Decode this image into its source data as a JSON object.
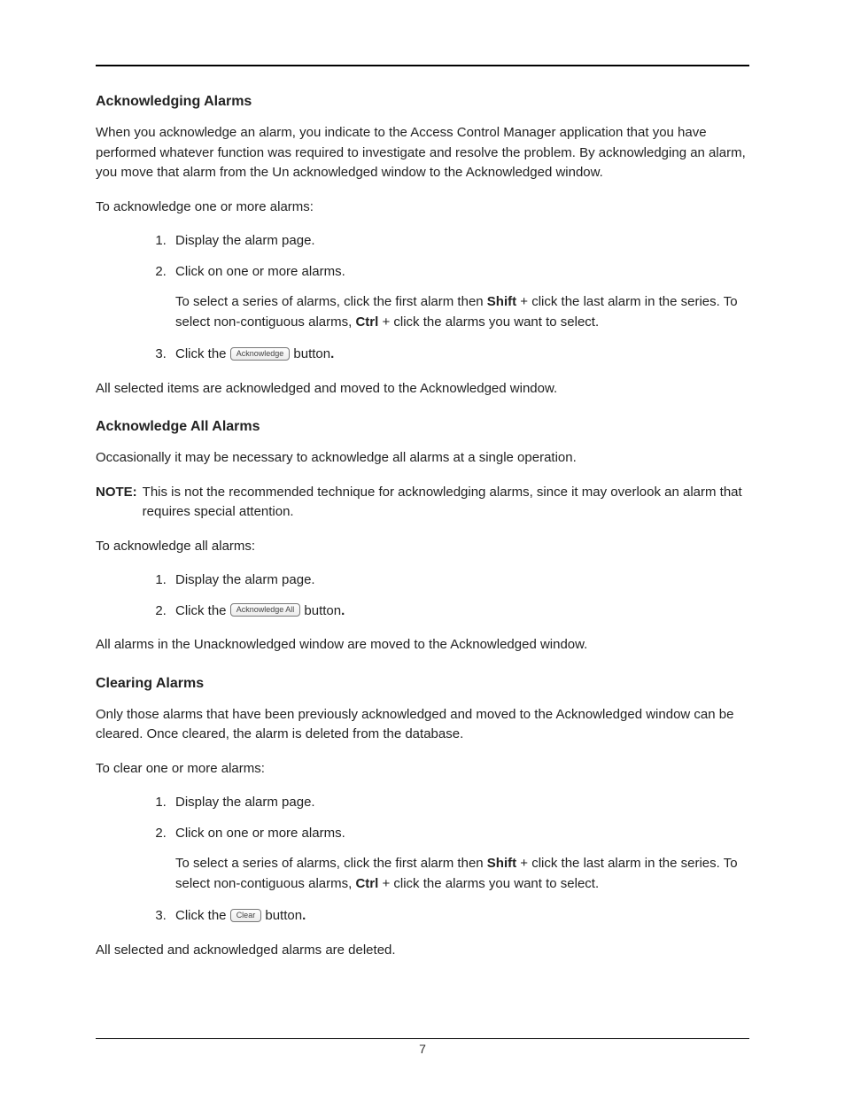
{
  "section1": {
    "heading": "Acknowledging Alarms",
    "intro": "When you acknowledge an alarm, you indicate to the Access Control Manager application that you have performed whatever function was required to investigate and resolve the problem. By acknowledging an alarm, you move that alarm from the Un acknowledged window to the Acknowledged window.",
    "lead": "To acknowledge one or more alarms:",
    "step1": "Display the alarm page.",
    "step2": "Click on one or more alarms.",
    "step2_sub_a": "To select a series of alarms, click the first alarm then ",
    "step2_shift": "Shift",
    "step2_sub_b": " + click the last alarm in the series. To select non-contiguous alarms, ",
    "step2_ctrl": "Ctrl",
    "step2_sub_c": " + click the alarms you want to select.",
    "step3_a": "Click the ",
    "step3_btn": "Acknowledge",
    "step3_b": " button",
    "step3_period": ".",
    "outro": "All selected items are acknowledged and moved to the Acknowledged window."
  },
  "section2": {
    "heading": "Acknowledge All Alarms",
    "intro": "Occasionally it may be necessary to acknowledge all alarms at a single operation.",
    "note_label": "NOTE:",
    "note_body": "This is not the recommended technique for acknowledging alarms, since it may overlook an alarm that requires special attention.",
    "lead": "To acknowledge all alarms:",
    "step1": "Display the alarm page.",
    "step2_a": "Click the ",
    "step2_btn": "Acknowledge All",
    "step2_b": " button",
    "step2_period": ".",
    "outro": "All alarms in the Unacknowledged window are moved to the Acknowledged window."
  },
  "section3": {
    "heading": "Clearing Alarms",
    "intro": "Only those alarms that have been previously acknowledged and moved to the Acknowledged window can be cleared. Once cleared, the alarm is deleted from the database.",
    "lead": "To clear one or more alarms:",
    "step1": "Display the alarm page.",
    "step2": "Click on one or more alarms.",
    "step2_sub_a": "To select a series of alarms, click the first alarm then ",
    "step2_shift": "Shift",
    "step2_sub_b": " + click the last alarm in the series. To select non-contiguous alarms, ",
    "step2_ctrl": "Ctrl",
    "step2_sub_c": " + click the alarms you want to select.",
    "step3_a": "Click the ",
    "step3_btn": "Clear",
    "step3_b": " button",
    "step3_period": ".",
    "outro": "All selected and acknowledged alarms are deleted."
  },
  "page_number": "7"
}
